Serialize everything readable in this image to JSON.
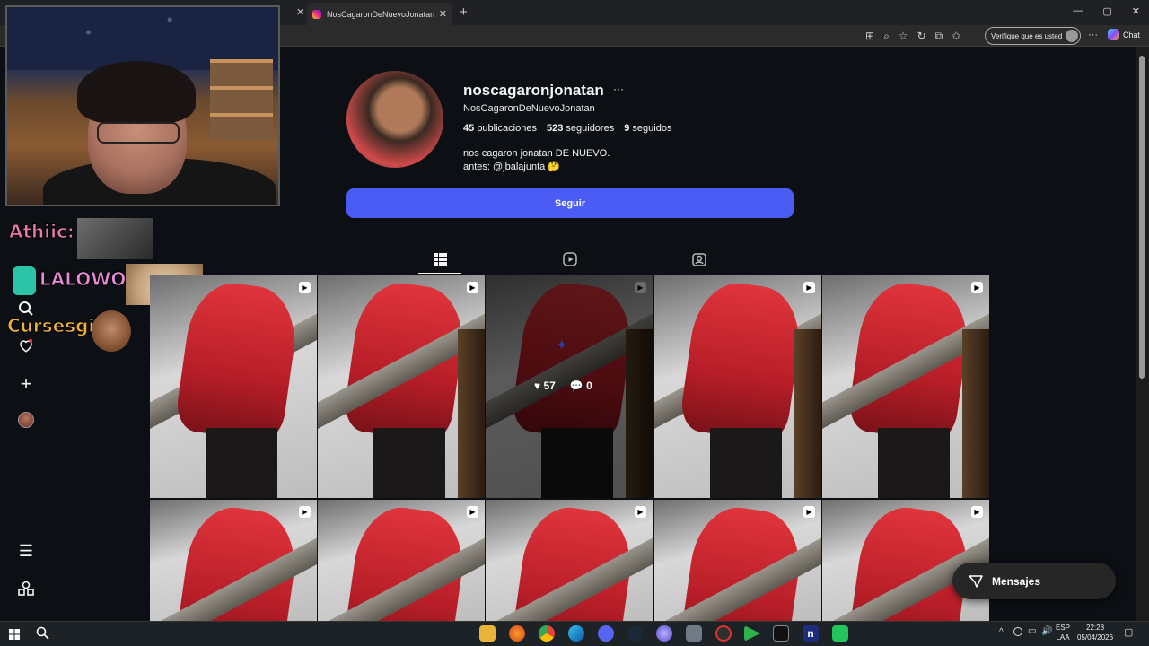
{
  "browser": {
    "tab_title": "NosCagaronDeNuevoJonatan (@n",
    "tab_close": "✕",
    "new_tab": "+",
    "verify_label": "Verifique que es usted",
    "chat_label": "Chat",
    "window_buttons": [
      "—",
      "▢",
      "✕"
    ]
  },
  "stream_chat": {
    "lines": [
      {
        "name": "Athiic:",
        "color": "#e87aa6"
      },
      {
        "name": "LALOWO:",
        "color": "#e58bd6"
      },
      {
        "name": "Cursesgi:",
        "color": "#f1b43a"
      }
    ]
  },
  "profile": {
    "username": "noscagaronjonatan",
    "more": "···",
    "full_name": "NosCagaronDeNuevoJonatan",
    "posts_count": "45",
    "posts_label": "publicaciones",
    "followers_count": "523",
    "followers_label": "seguidores",
    "following_count": "9",
    "following_label": "seguidos",
    "bio_line1": "nos cagaron jonatan DE NUEVO.",
    "bio_line2": "antes: @jbalajunta 🤔",
    "follow_label": "Seguir"
  },
  "hover_post": {
    "likes": "57",
    "comments": "0"
  },
  "messages": {
    "label": "Mensajes"
  },
  "taskbar": {
    "lang_line1": "ESP",
    "lang_line2": "LAA",
    "time": "22:28",
    "date": "05/04/2026"
  },
  "colors": {
    "follow_button": "#4a5cf3",
    "background": "#0c1014"
  }
}
